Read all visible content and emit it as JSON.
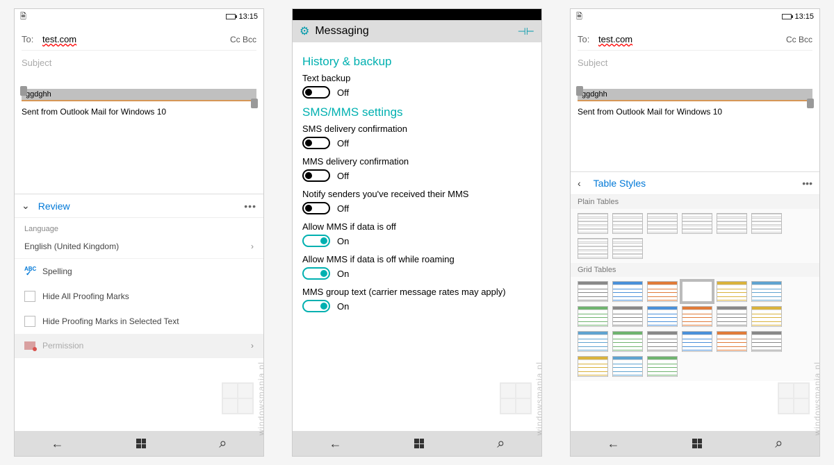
{
  "status": {
    "time": "13:15"
  },
  "compose": {
    "to_label": "To:",
    "to_value": "test.com",
    "ccbcc": "Cc Bcc",
    "subject_placeholder": "Subject",
    "selected_text": "ggdghh",
    "signature": "Sent from Outlook Mail for Windows 10"
  },
  "review": {
    "title": "Review",
    "language_label": "Language",
    "language_value": "English (United Kingdom)",
    "spelling": "Spelling",
    "hide_all": "Hide All Proofing Marks",
    "hide_sel": "Hide Proofing Marks in Selected Text",
    "permission": "Permission"
  },
  "messaging": {
    "title": "Messaging",
    "section1": "History & backup",
    "section2": "SMS/MMS settings",
    "items": [
      {
        "label": "Text backup",
        "state": "Off",
        "on": false
      },
      {
        "label": "SMS delivery confirmation",
        "state": "Off",
        "on": false
      },
      {
        "label": "MMS delivery confirmation",
        "state": "Off",
        "on": false
      },
      {
        "label": "Notify senders you've received their MMS",
        "state": "Off",
        "on": false
      },
      {
        "label": "Allow MMS if data is off",
        "state": "On",
        "on": true
      },
      {
        "label": "Allow MMS if data is off while roaming",
        "state": "On",
        "on": true
      },
      {
        "label": "MMS group text (carrier message rates may apply)",
        "state": "On",
        "on": true
      }
    ]
  },
  "tablestyles": {
    "title": "Table Styles",
    "plain_label": "Plain Tables",
    "grid_label": "Grid Tables",
    "grid_colors": [
      "#888",
      "#4a90d9",
      "#e07b39",
      "#888",
      "#d9b23c",
      "#5fa3d0",
      "#6fb36f",
      "#888",
      "#4a90d9",
      "#e07b39",
      "#888",
      "#d9b23c",
      "#5fa3d0",
      "#6fb36f",
      "#888",
      "#4a90d9",
      "#e07b39",
      "#888",
      "#d9b23c",
      "#5fa3d0",
      "#6fb36f"
    ]
  },
  "watermark": "windowsmania.pl"
}
